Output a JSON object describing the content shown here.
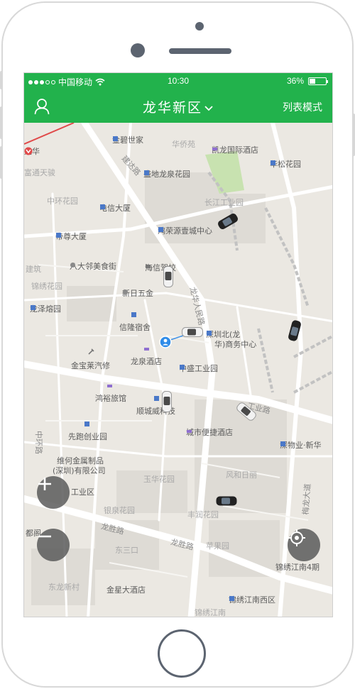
{
  "status_bar": {
    "carrier": "中国移动",
    "time": "10:30",
    "battery": "36%",
    "battery_level": 0.36
  },
  "nav": {
    "title": "龙华新区",
    "right_label": "列表模式",
    "user_icon": "user-icon",
    "dropdown_icon": "chevron-down-icon"
  },
  "map": {
    "labels": {
      "longhua_metro": "龙华",
      "jinbi": "金碧世家",
      "huaqiao": "华侨苑",
      "kailong": "凯龙国际酒店",
      "fudun": "富通天骏",
      "jianda_road": "建达路",
      "shengdi": "盛地龙泉花园",
      "huasong": "华松花园",
      "zhonghuan": "中环花园",
      "dianxin": "电信大厦",
      "changjiang": "长江工业园",
      "renmin_n_road": "人民北路",
      "dizun": "帝尊大厦",
      "hongrong": "鸿荣源壹城中心",
      "bada": "八大邻美食街",
      "haixin": "海信驾校",
      "jianzhu": "建筑",
      "jinxiu": "锦绣花园",
      "xinri": "新日五金",
      "longze": "龙泽熔园",
      "longhua_renmin": "龙华人民路",
      "xinlong": "信隆宿舍",
      "shenzhen_north1": "深圳北(龙",
      "shenzhen_north2": "华)商务中心",
      "jinbao": "金宝莱汽修",
      "longquan_hotel": "龙泉酒店",
      "zhongsheng": "中盛工业园",
      "hongyu": "鸿裕旅馆",
      "shunwei": "顺城威科技",
      "gongye_road": "工业路",
      "xianchi": "先跑创业园",
      "chengshi": "城市便捷酒店",
      "shenwu": "深物业·新华",
      "zhonghuan_road": "中环路",
      "weihe1": "维何金属制品",
      "weihe2": "(深圳)有限公司",
      "fenghe": "风和日丽",
      "yuhua": "玉华花园",
      "gongyequ": "工业区",
      "meilong": "梅龙大道",
      "yinyuan": "银泉花园",
      "fengrun": "丰润花园",
      "dudu": "都阁",
      "longsheng1": "龙胜路",
      "longsheng2": "龙胜路",
      "dongsan": "东三口",
      "pingguo": "苹果园",
      "jinxiu4": "锦绣江南4期",
      "donglong": "东龙新村",
      "jinxing": "金星大酒店",
      "jinxiu_west": "锦绣江南西区",
      "jinxiu_jn": "锦绣江南"
    },
    "zoom_in_icon": "plus-icon",
    "zoom_out_icon": "minus-icon",
    "locate_icon": "crosshair-icon",
    "car_icon": "car-icon",
    "location_icon": "user-location-icon"
  },
  "colors": {
    "brand_green": "#22b24c",
    "map_bg": "#ebe8e2",
    "road": "#ffffff",
    "park": "#c8e2b0",
    "poi_blue": "#4a78c8",
    "poi_purple": "#8f6fd0"
  }
}
